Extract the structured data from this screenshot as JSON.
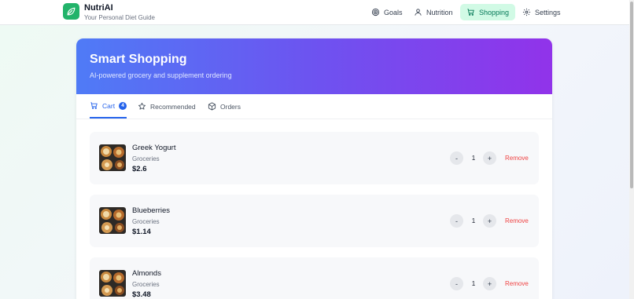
{
  "brand": {
    "name": "NutriAI",
    "tagline": "Your Personal Diet Guide",
    "logo_icon": "leaf-chat-icon",
    "color": "#22b36a"
  },
  "nav": {
    "items": [
      {
        "label": "Goals",
        "icon": "target-icon",
        "active": false
      },
      {
        "label": "Nutrition",
        "icon": "user-icon",
        "active": false
      },
      {
        "label": "Shopping",
        "icon": "cart-icon",
        "active": true
      },
      {
        "label": "Settings",
        "icon": "gear-icon",
        "active": false
      }
    ]
  },
  "hero": {
    "title": "Smart Shopping",
    "subtitle": "AI-powered grocery and supplement ordering",
    "gradient": [
      "#4f7bf6",
      "#9133ea"
    ]
  },
  "tabs": [
    {
      "label": "Cart",
      "icon": "cart-icon",
      "badge": "4",
      "active": true
    },
    {
      "label": "Recommended",
      "icon": "star-icon",
      "active": false
    },
    {
      "label": "Orders",
      "icon": "package-icon",
      "active": false
    }
  ],
  "cart": {
    "remove_label": "Remove",
    "decrement_label": "-",
    "increment_label": "+",
    "items": [
      {
        "name": "Greek Yogurt",
        "category": "Groceries",
        "price": "$2.6",
        "quantity": "1"
      },
      {
        "name": "Blueberries",
        "category": "Groceries",
        "price": "$1.14",
        "quantity": "1"
      },
      {
        "name": "Almonds",
        "category": "Groceries",
        "price": "$3.48",
        "quantity": "1"
      }
    ]
  },
  "colors": {
    "accent_blue": "#2563eb",
    "active_nav_bg": "#d1fae5",
    "active_nav_text": "#047857",
    "remove_red": "#ef4444"
  }
}
